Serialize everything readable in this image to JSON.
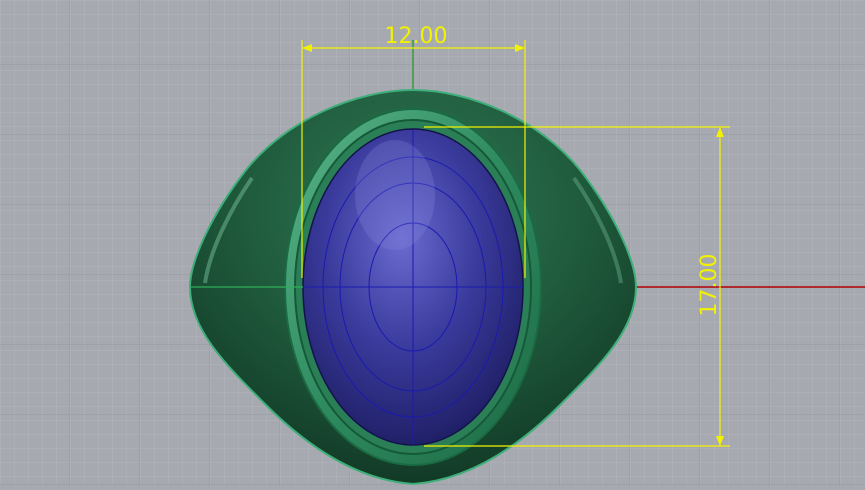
{
  "viewport": {
    "colors": {
      "background": "#a6aab0",
      "grid_minor": "#b2b6bb",
      "grid_major": "#95999f",
      "axis_x": "#b00000",
      "axis_y": "#2f9a2f",
      "dimension": "#f2f200",
      "ring_band": "#1f5a3c",
      "bezel": "#2e8a5f",
      "stone": "#3a3a9c"
    }
  },
  "dimensions": {
    "width_label": "12.00",
    "height_label": "17.00"
  }
}
